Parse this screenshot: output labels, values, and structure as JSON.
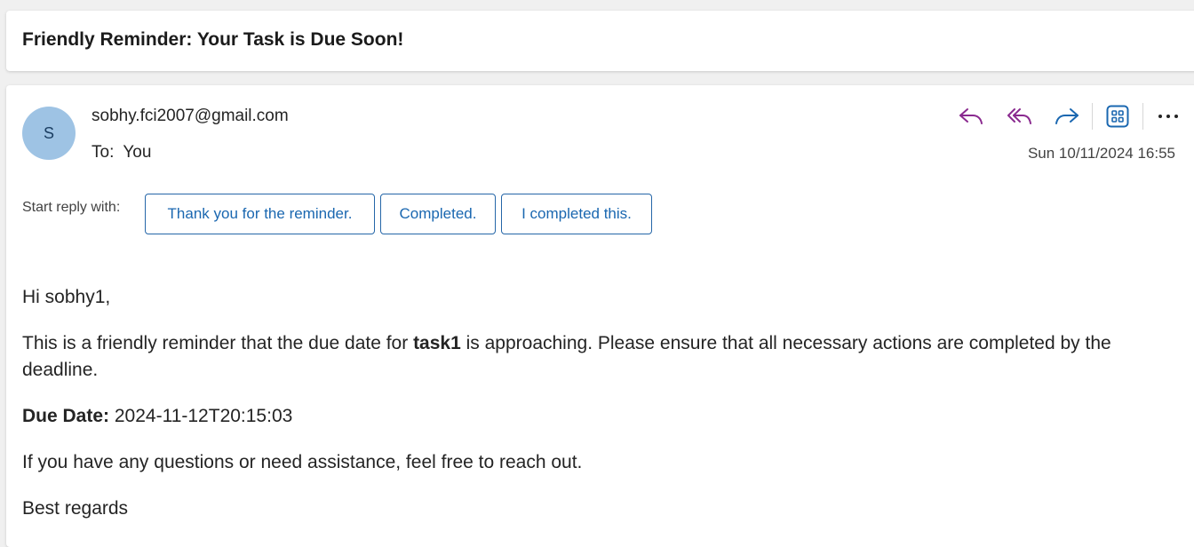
{
  "subject": "Friendly Reminder: Your Task is Due Soon!",
  "message": {
    "avatar_initial": "S",
    "sender": "sobhy.fci2007@gmail.com",
    "to_label": "To:",
    "to_value": "You",
    "date": "Sun 10/11/2024 16:55",
    "toolbar": [
      {
        "name": "reply-icon",
        "color": "#8a2a8f"
      },
      {
        "name": "reply-all-icon",
        "color": "#8a2a8f"
      },
      {
        "name": "forward-icon",
        "color": "#1a67b0"
      },
      {
        "name": "apps-icon",
        "color": "#1a67b0"
      },
      {
        "name": "more-icon",
        "color": "#242424"
      }
    ]
  },
  "suggested_replies": {
    "label": "Start reply with:",
    "items": [
      "Thank you for the reminder.",
      "Completed.",
      "I completed this."
    ]
  },
  "body": {
    "greeting": "Hi sobhy1,",
    "p1_before": "This is a friendly reminder that the due date for ",
    "p1_task": "task1",
    "p1_after": " is approaching. Please ensure that all necessary actions are completed by the deadline.",
    "due_label": "Due Date:",
    "due_value": "2024-11-12T20:15:03",
    "p3": "If you have any questions or need assistance, feel free to reach out.",
    "closing": "Best regards"
  },
  "colors": {
    "accent": "#1a67b0",
    "reply_accent": "#8a2a8f",
    "avatar_bg": "#9ec3e4"
  }
}
